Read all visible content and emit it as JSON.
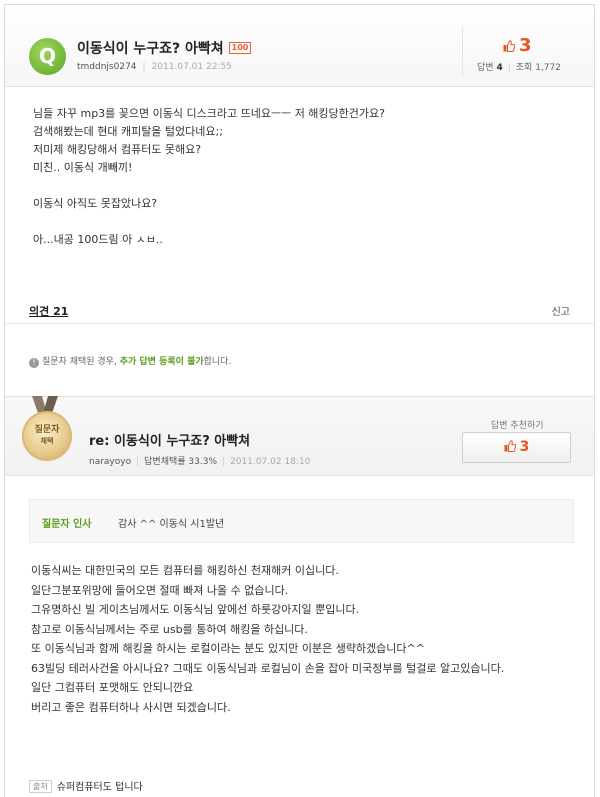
{
  "question": {
    "badge": "Q",
    "title": "이동식이 누구죠? 아빡쳐",
    "points": "100",
    "author": "tmddnjs0274",
    "date": "2011.07.01 22:55",
    "recommend_count": "3",
    "answers_label": "답변",
    "answers_count": "4",
    "views_label": "조회",
    "views_count": "1,772",
    "body_lines": [
      "님들 자꾸 mp3를 꽂으면 이동식 디스크라고 뜨네요ㅡㅡ 저 해킹당한건가요?",
      "검색해봤는데 현대 캐피탈을 털었다네요;;",
      "저미제 해킹당해서 컴퓨터도 못해요?",
      "미친.. 이동식 개빼끼!",
      "이동식 아직도 못잡았나요?",
      "아...내공 100드림 아 ㅅㅂ.."
    ],
    "opinion_label": "의견 21",
    "report_label": "신고",
    "notice_before": "질문자 채택된 경우,",
    "notice_highlight": "추가 답변 등록이 불가",
    "notice_after": "합니다."
  },
  "answer": {
    "medal_line1": "질문자",
    "medal_line2": "채택",
    "title": "re: 이동식이 누구죠? 아빡쳐",
    "author": "narayoyo",
    "adoption_label": "답변채택률 33.3%",
    "date": "2011.07.02 18:10",
    "recommend_label": "답변 추천하기",
    "recommend_count": "3",
    "thanks_label": "질문자 인사",
    "thanks_text": "감사 ^^ 이동식 시1발년",
    "body_lines": [
      "이동식씨는 대한민국의 모든 컴퓨터를 해킹하신 천재해커 이십니다.",
      "일단그분포위망에 들어오면 절때 빠져 나올 수 없습니다.",
      "그유명하신 빌 게이츠님께서도 이동식님 앞에선 하룻강아지일 뿐입니다.",
      "참고로 이동식님께서는 주로 usb를 통하여 해킹을 하십니다.",
      "또 이동식님과 함께 해킹을 하시는 로컬이라는 분도 있지만 이분은 생략하겠습니다^^",
      "63빌딩 테러사건을 아시나요? 그때도 이동식님과 로컬님이 손을 잡아 미국정부를 털걸로 알고있습니다.",
      "일단 그컴퓨터 포맷해도 안되니깐요",
      "버리고 좋은 컴퓨터하나 사시면 되겠습니다."
    ],
    "source_label": "출처",
    "source_text": "슈퍼컴퓨터도 텁니다"
  },
  "colors": {
    "accent_green": "#5b9b1b",
    "recommend_orange": "#e8561e",
    "badge_green": "#6ab52c"
  },
  "icons": [
    "thumb-up-icon",
    "info-icon",
    "medal-icon"
  ]
}
